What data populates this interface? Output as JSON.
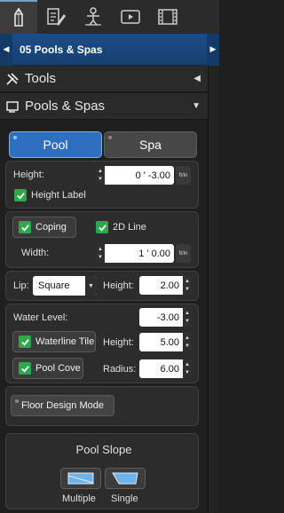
{
  "toolbar": {
    "tools": [
      {
        "icon": "pencil-icon",
        "active": true
      },
      {
        "icon": "edit-document-icon",
        "active": false
      },
      {
        "icon": "scene-figure-icon",
        "active": false
      },
      {
        "icon": "video-play-icon",
        "active": false
      },
      {
        "icon": "film-strip-icon",
        "active": false
      }
    ]
  },
  "page_selector": {
    "title": "05 Pools & Spas"
  },
  "sections": {
    "tools": {
      "label": "Tools"
    },
    "pools": {
      "label": "Pools & Spas"
    }
  },
  "tabs": {
    "pool": "Pool",
    "spa": "Spa"
  },
  "height_panel": {
    "height_label": "Height:",
    "height_value": "0 ' -3.00",
    "unit": "ft/in",
    "height_label_checkbox": "Height Label"
  },
  "coping_panel": {
    "coping_label": "Coping",
    "line_2d_label": "2D Line",
    "width_label": "Width:",
    "width_value": "1 ' 0.00",
    "unit": "ft/in"
  },
  "lip_panel": {
    "lip_label": "Lip:",
    "lip_value": "Square",
    "height_label": "Height:",
    "height_value": "2.00"
  },
  "water_panel": {
    "water_level_label": "Water Level:",
    "water_level_value": "-3.00",
    "waterline_tile_label": "Waterline Tile",
    "tile_height_label": "Height:",
    "tile_height_value": "5.00",
    "pool_cove_label": "Pool Cove",
    "radius_label": "Radius:",
    "radius_value": "6.00"
  },
  "floor_design": {
    "label": "Floor Design Mode"
  },
  "pool_slope": {
    "title": "Pool Slope",
    "multiple_label": "Multiple",
    "single_label": "Single"
  },
  "colors": {
    "accent": "#2e6fc0",
    "check": "#2fa84d",
    "header": "#1c4e87"
  }
}
